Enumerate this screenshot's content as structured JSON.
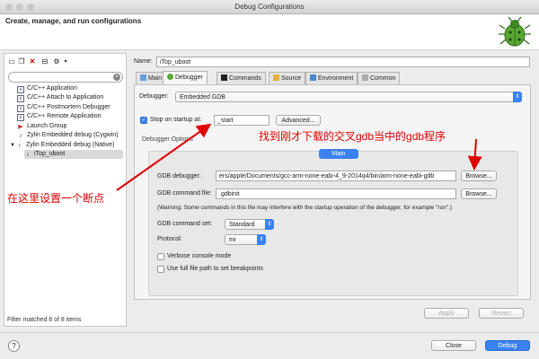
{
  "window": {
    "title": "Debug Configurations"
  },
  "header": {
    "title": "Create, manage, and run configurations"
  },
  "left": {
    "toolbar_icons": [
      "new-config-icon",
      "duplicate-icon",
      "delete-icon",
      "collapse-all-icon",
      "filter-icon",
      "chevron-down-icon"
    ],
    "filter_placeholder": "",
    "tree": [
      {
        "label": "C/C++ Application",
        "icon": "c-app-icon"
      },
      {
        "label": "C/C++ Attach to Application",
        "icon": "c-attach-icon"
      },
      {
        "label": "C/C++ Postmortem Debugger",
        "icon": "c-postmortem-icon"
      },
      {
        "label": "C/C++ Remote Application",
        "icon": "c-remote-icon"
      },
      {
        "label": "Launch Group",
        "icon": "launch-group-icon"
      },
      {
        "label": "Zylin Embedded debug (Cygwin)",
        "icon": "zylin-icon"
      },
      {
        "label": "Zylin Embedded debug (Native)",
        "icon": "zylin-icon"
      },
      {
        "label": "iTop_uboot",
        "icon": "zylin-icon"
      }
    ],
    "status": "Filter matched 8 of 8 items"
  },
  "main": {
    "name_label": "Name:",
    "name_value": "iTop_uboot",
    "tabs": [
      "Main",
      "Debugger",
      "Commands",
      "Source",
      "Environment",
      "Common"
    ],
    "debugger_label": "Debugger:",
    "debugger_value": "Embedded GDB",
    "stop_on_startup_label": "Stop on startup at:",
    "stop_on_startup_value": "_start",
    "advanced_button": "Advanced...",
    "options_group": "Debugger Options",
    "options_tab": "Main",
    "gdb_debugger_label": "GDB debugger:",
    "gdb_debugger_value": "ers/apple/Documents/gcc-arm-none-eabi-4_9-2014q4/bin/arm-none-eabi-gdb",
    "browse1": "Browse...",
    "gdb_cmd_label": "GDB command file:",
    "gdb_cmd_value": ".gdbinit",
    "browse2": "Browse...",
    "warning": "(Warning: Some commands in this file may interfere with the startup operation of the debugger, for example \"run\".)",
    "cmdset_label": "GDB command set:",
    "cmdset_value": "Standard",
    "protocol_label": "Protocol:",
    "protocol_value": "mi",
    "verbose_label": "Verbose console mode",
    "fullpath_label": "Use full file path to set breakpoints",
    "apply": "Apply",
    "revert": "Revert"
  },
  "footer": {
    "help": "?",
    "close": "Close",
    "debug": "Debug"
  },
  "annotations": {
    "left_note": "在这里设置一个断点",
    "top_note": "找到刚才下载的交叉gdb当中的gdb程序"
  },
  "colors": {
    "accent": "#3b82f0",
    "annotation": "#e00000"
  }
}
